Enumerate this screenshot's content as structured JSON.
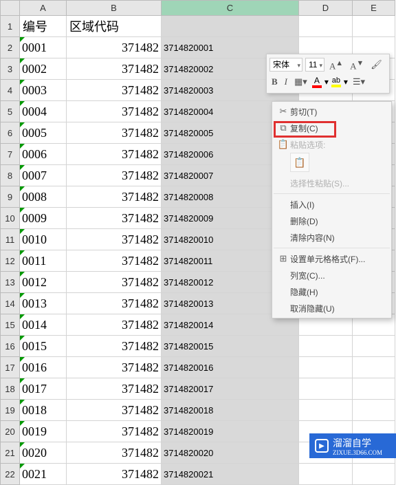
{
  "columns": [
    "A",
    "B",
    "C",
    "D",
    "E"
  ],
  "headers": {
    "A": "编号",
    "B": "区域代码"
  },
  "rows": [
    {
      "n": 1,
      "A": "0001",
      "B": "371482",
      "C": "3714820001"
    },
    {
      "n": 2,
      "A": "0002",
      "B": "371482",
      "C": "3714820002"
    },
    {
      "n": 3,
      "A": "0003",
      "B": "371482",
      "C": "3714820003"
    },
    {
      "n": 4,
      "A": "0004",
      "B": "371482",
      "C": "3714820004"
    },
    {
      "n": 5,
      "A": "0005",
      "B": "371482",
      "C": "3714820005"
    },
    {
      "n": 6,
      "A": "0006",
      "B": "371482",
      "C": "3714820006"
    },
    {
      "n": 7,
      "A": "0007",
      "B": "371482",
      "C": "3714820007"
    },
    {
      "n": 8,
      "A": "0008",
      "B": "371482",
      "C": "3714820008"
    },
    {
      "n": 9,
      "A": "0009",
      "B": "371482",
      "C": "3714820009"
    },
    {
      "n": 10,
      "A": "0010",
      "B": "371482",
      "C": "3714820010"
    },
    {
      "n": 11,
      "A": "0011",
      "B": "371482",
      "C": "3714820011"
    },
    {
      "n": 12,
      "A": "0012",
      "B": "371482",
      "C": "3714820012"
    },
    {
      "n": 13,
      "A": "0013",
      "B": "371482",
      "C": "3714820013"
    },
    {
      "n": 14,
      "A": "0014",
      "B": "371482",
      "C": "3714820014"
    },
    {
      "n": 15,
      "A": "0015",
      "B": "371482",
      "C": "3714820015"
    },
    {
      "n": 16,
      "A": "0016",
      "B": "371482",
      "C": "3714820016"
    },
    {
      "n": 17,
      "A": "0017",
      "B": "371482",
      "C": "3714820017"
    },
    {
      "n": 18,
      "A": "0018",
      "B": "371482",
      "C": "3714820018"
    },
    {
      "n": 19,
      "A": "0019",
      "B": "371482",
      "C": "3714820019"
    },
    {
      "n": 20,
      "A": "0020",
      "B": "371482",
      "C": "3714820020"
    },
    {
      "n": 21,
      "A": "0021",
      "B": "371482",
      "C": "3714820021"
    }
  ],
  "mini_toolbar": {
    "font_name": "宋体",
    "font_size": "11",
    "btn_a_plus": "A",
    "btn_a_minus": "A",
    "bold": "B",
    "italic": "I"
  },
  "context_menu": {
    "cut": "剪切(T)",
    "copy": "复制(C)",
    "paste_options": "粘贴选项:",
    "paste_special": "选择性粘贴(S)...",
    "insert": "插入(I)",
    "delete": "删除(D)",
    "clear": "清除内容(N)",
    "format_cells": "设置单元格格式(F)...",
    "col_width": "列宽(C)...",
    "hide": "隐藏(H)",
    "unhide": "取消隐藏(U)"
  },
  "watermark": {
    "brand": "溜溜自学",
    "url": "ZIXUE.3D66.COM"
  }
}
